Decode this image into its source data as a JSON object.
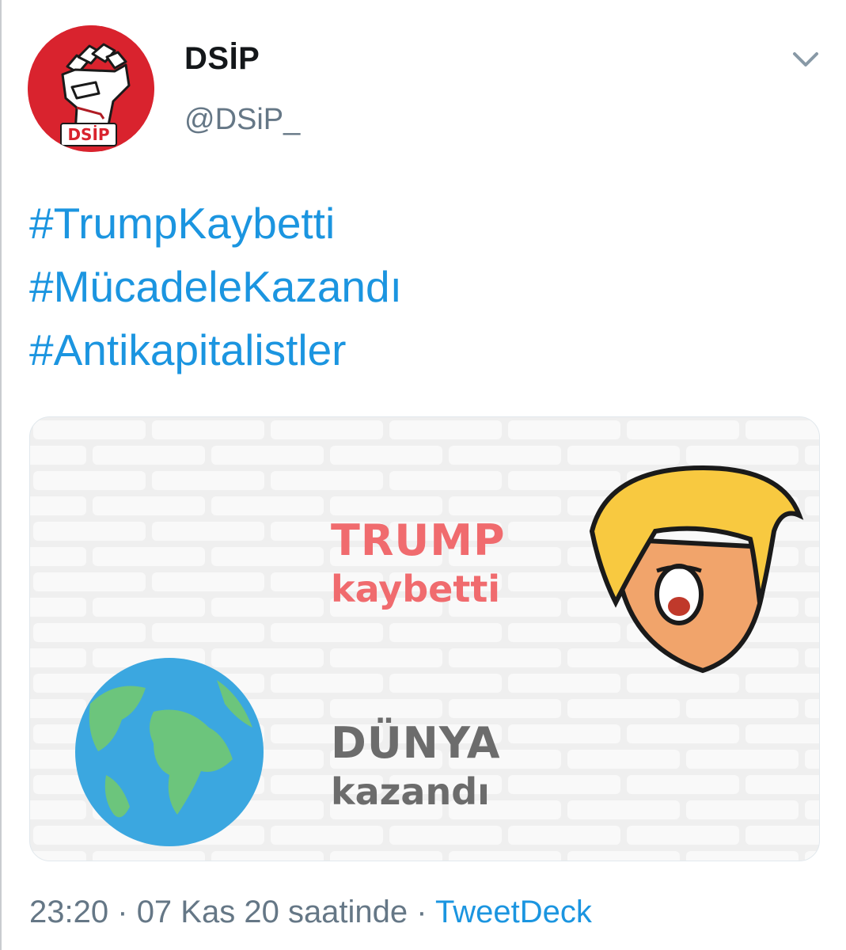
{
  "tweet": {
    "display_name": "DSİP",
    "handle": "@DSiP_",
    "avatar_label": "DSİP",
    "hashtags": [
      "#TrumpKaybetti",
      "#MücadeleKazandı",
      "#Antikapitalistler"
    ],
    "time": "23:20",
    "separator": "·",
    "date_text": "07 Kas 20 saatinde",
    "source": "TweetDeck"
  },
  "media": {
    "trump_title": "TRUMP",
    "trump_sub": "kaybetti",
    "dunya_title": "DÜNYA",
    "dunya_sub": "kazandı"
  },
  "colors": {
    "link": "#1b95e0",
    "avatar_red": "#d9232e",
    "trump_text": "#f06b6e",
    "dunya_text": "#6c6c6c"
  },
  "icons": [
    "fist-icon",
    "chevron-down-icon",
    "globe-icon",
    "trump-caricature"
  ]
}
